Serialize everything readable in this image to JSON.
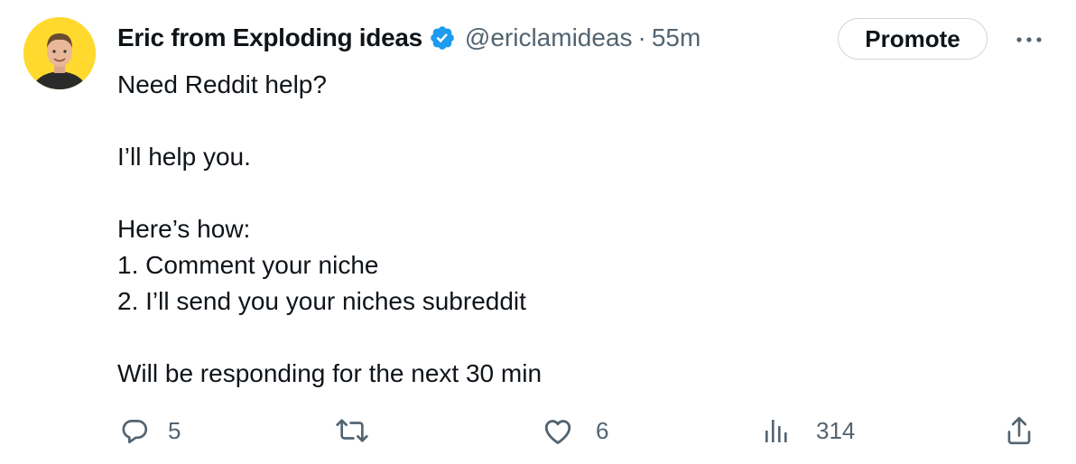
{
  "author": {
    "display_name": "Eric from Exploding ideas",
    "handle": "@ericlamideas",
    "separator": "·",
    "time": "55m",
    "avatar_bg": "#ffd92e",
    "verified_color": "#1d9bf0"
  },
  "promote_label": "Promote",
  "body_lines": [
    "Need Reddit help?",
    "",
    "I’ll help you.",
    "",
    "Here’s how:",
    "1. Comment your niche",
    "2. I’ll send you your niches subreddit",
    "",
    "Will be responding for the next 30 min"
  ],
  "actions": {
    "reply_count": "5",
    "retweet_count": "",
    "like_count": "6",
    "views_count": "314"
  },
  "icons": {
    "reply": "reply-icon",
    "retweet": "retweet-icon",
    "like": "heart-icon",
    "views": "analytics-icon",
    "share": "share-icon",
    "more": "more-icon",
    "verified": "verified-badge-icon"
  }
}
